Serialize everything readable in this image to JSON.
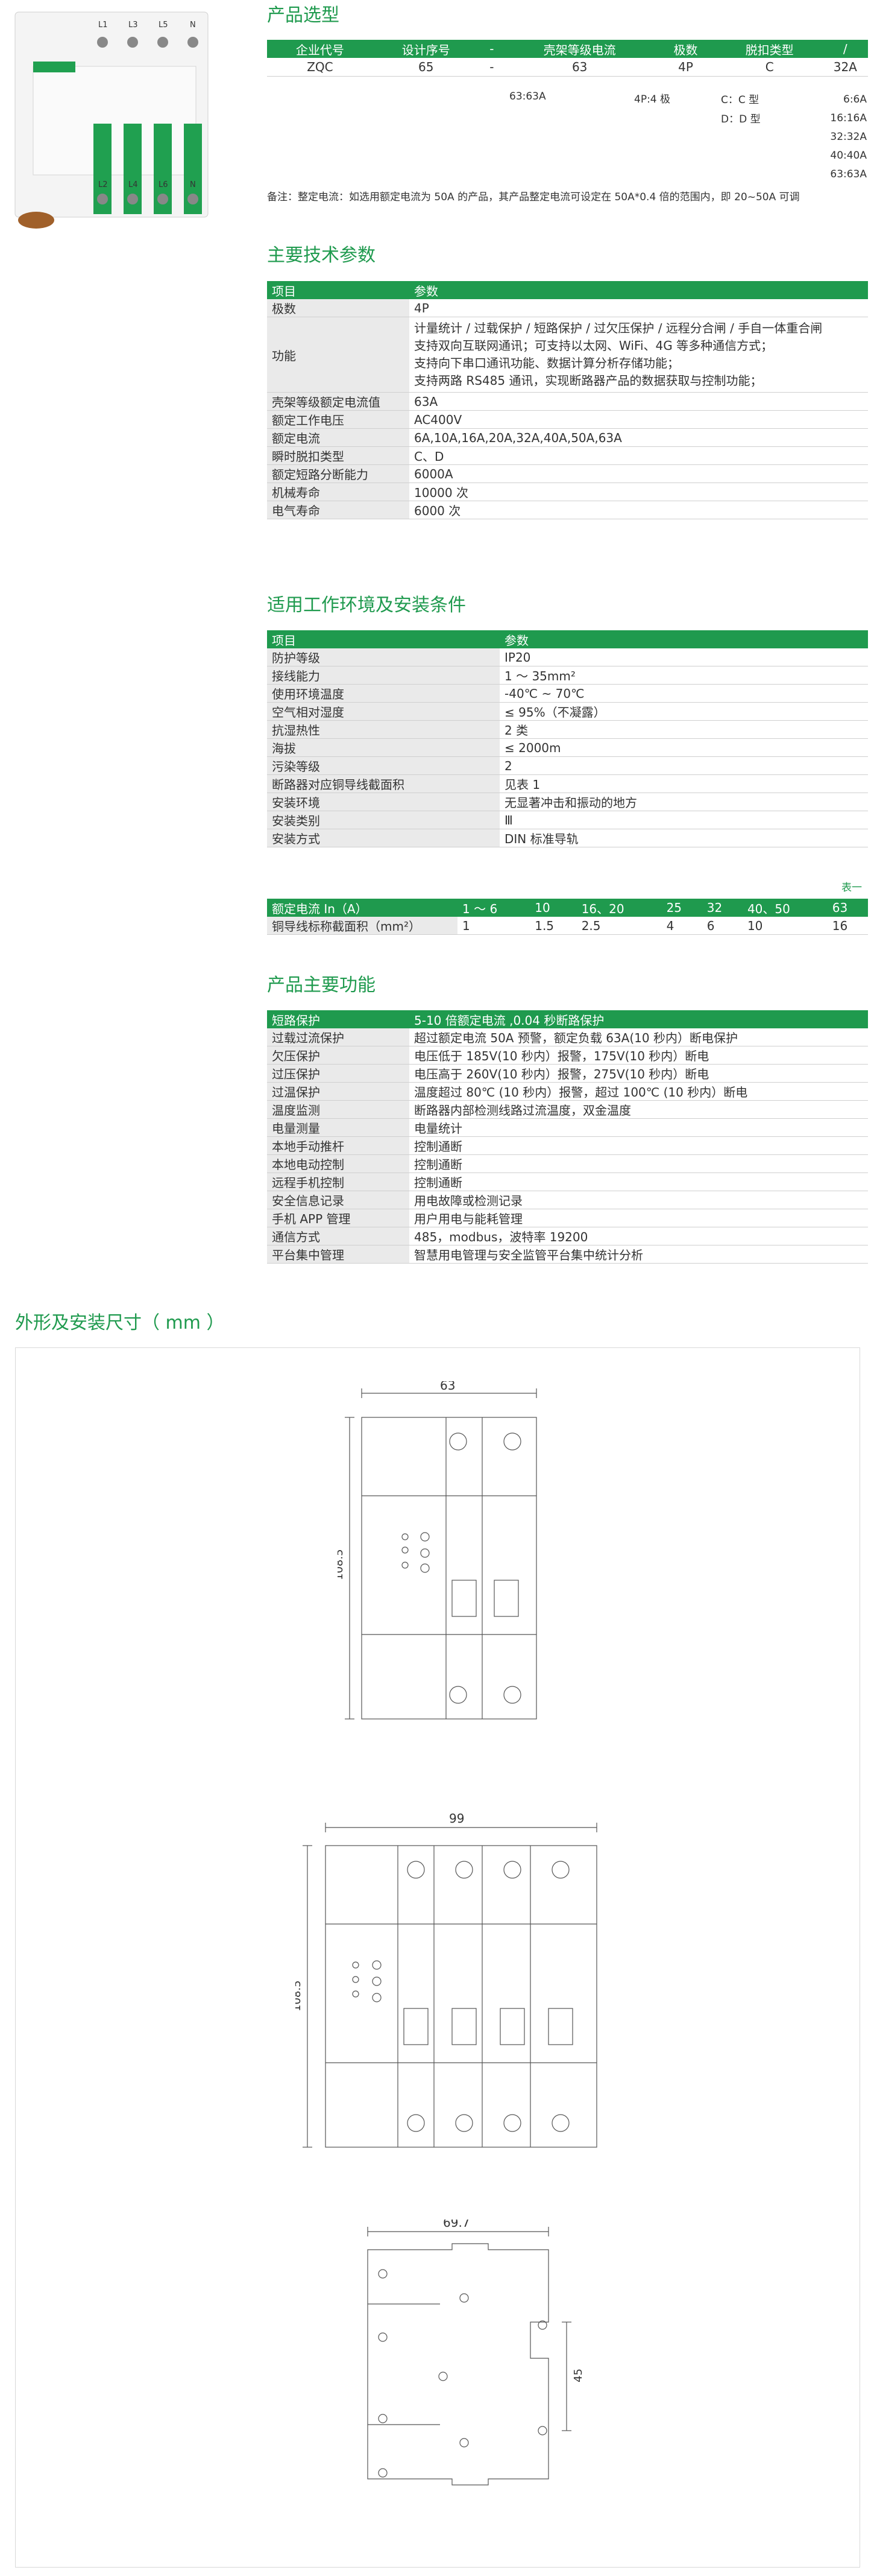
{
  "product": {
    "image_labels_top": [
      "L1",
      "L3",
      "L5",
      "N"
    ],
    "image_labels_bottom": [
      "L2",
      "L4",
      "L6",
      "N"
    ]
  },
  "selection": {
    "title": "产品选型",
    "headers": [
      "企业代号",
      "设计序号",
      "-",
      "壳架等级电流",
      "极数",
      "脱扣类型",
      "/"
    ],
    "values": [
      "ZQC",
      "65",
      "-",
      "63",
      "4P",
      "C",
      "32A"
    ],
    "frame_note": "63:63A",
    "pole_note": "4P:4 极",
    "trip_notes": [
      "C：C 型",
      "D：D 型"
    ],
    "current_notes": [
      "6:6A",
      "16:16A",
      "32:32A",
      "40:40A",
      "63:63A"
    ],
    "remark": "备注：整定电流：如选用额定电流为 50A 的产品，其产品整定电流可设定在 50A*0.4 倍的范围内，即 20~50A 可调"
  },
  "tech": {
    "title": "主要技术参数",
    "headers": [
      "项目",
      "参数"
    ],
    "rows": [
      {
        "k": "极数",
        "v": [
          "4P"
        ]
      },
      {
        "k": "功能",
        "v": [
          "计量统计 / 过载保护 / 短路保护 / 过欠压保护 / 远程分合闸 / 手自一体重合闸",
          "支持双向互联网通讯；可支持以太网、WiFi、4G 等多种通信方式；",
          "支持向下串口通讯功能、数据计算分析存储功能；",
          "支持两路 RS485 通讯，实现断路器产品的数据获取与控制功能；"
        ]
      },
      {
        "k": "壳架等级额定电流值",
        "v": [
          "63A"
        ]
      },
      {
        "k": "额定工作电压",
        "v": [
          "AC400V"
        ]
      },
      {
        "k": "额定电流",
        "v": [
          "6A,10A,16A,20A,32A,40A,50A,63A"
        ]
      },
      {
        "k": "瞬时脱扣类型",
        "v": [
          "C、D"
        ]
      },
      {
        "k": "额定短路分断能力",
        "v": [
          "6000A"
        ]
      },
      {
        "k": "机械寿命",
        "v": [
          "10000 次"
        ]
      },
      {
        "k": "电气寿命",
        "v": [
          "6000 次"
        ]
      }
    ]
  },
  "env": {
    "title": "适用工作环境及安装条件",
    "headers": [
      "项目",
      "参数"
    ],
    "rows": [
      [
        "防护等级",
        "IP20"
      ],
      [
        "接线能力",
        "1 ～ 35mm²"
      ],
      [
        "使用环境温度",
        "-40℃ ~ 70℃"
      ],
      [
        "空气相对湿度",
        "≤ 95%（不凝露）"
      ],
      [
        "抗湿热性",
        "2 类"
      ],
      [
        "海拔",
        "≤ 2000m"
      ],
      [
        "污染等级",
        "2"
      ],
      [
        "断路器对应铜导线截面积",
        "见表 1"
      ],
      [
        "安装环境",
        "无显著冲击和振动的地方"
      ],
      [
        "安装类别",
        "Ⅲ"
      ],
      [
        "安装方式",
        "DIN 标准导轨"
      ]
    ],
    "table1_label": "表一",
    "table1_headers": [
      "额定电流 In（A）",
      "1 ～ 6",
      "10",
      "16、20",
      "25",
      "32",
      "40、50",
      "63"
    ],
    "table1_values": [
      "铜导线标称截面积（mm²）",
      "1",
      "1.5",
      "2.5",
      "4",
      "6",
      "10",
      "16"
    ]
  },
  "functions": {
    "title": "产品主要功能",
    "headers": [
      "短路保护",
      "5-10 倍额定电流 ,0.04 秒断路保护"
    ],
    "rows": [
      [
        "过载过流保护",
        "超过额定电流 50A 预警，额定负载 63A(10 秒内）断电保护"
      ],
      [
        "欠压保护",
        "电压低于 185V(10 秒内）报警，175V(10 秒内）断电"
      ],
      [
        "过压保护",
        "电压高于 260V(10 秒内）报警，275V(10 秒内）断电"
      ],
      [
        "过温保护",
        "温度超过 80℃ (10 秒内）报警，超过 100℃ (10 秒内）断电"
      ],
      [
        "温度监测",
        "断路器内部检测线路过流温度，双金温度"
      ],
      [
        "电量测量",
        "电量统计"
      ],
      [
        "本地手动推杆",
        "控制通断"
      ],
      [
        "本地电动控制",
        "控制通断"
      ],
      [
        "远程手机控制",
        "控制通断"
      ],
      [
        "安全信息记录",
        "用电故障或检测记录"
      ],
      [
        "手机 APP 管理",
        "用户用电与能耗管理"
      ],
      [
        "通信方式",
        "485，modbus，波特率 19200"
      ],
      [
        "平台集中管理",
        "智慧用电管理与安全监管平台集中统计分析"
      ]
    ]
  },
  "dimensions": {
    "title": "外形及安装尺寸（ mm ）",
    "d1_width": "63",
    "d1_height": "108.5",
    "d2_width": "99",
    "d2_height": "108.5",
    "d3_width": "69.7",
    "d3_height": "45"
  },
  "colors": {
    "accent": "#1f9a4e",
    "label_bg": "#eaeaea"
  }
}
